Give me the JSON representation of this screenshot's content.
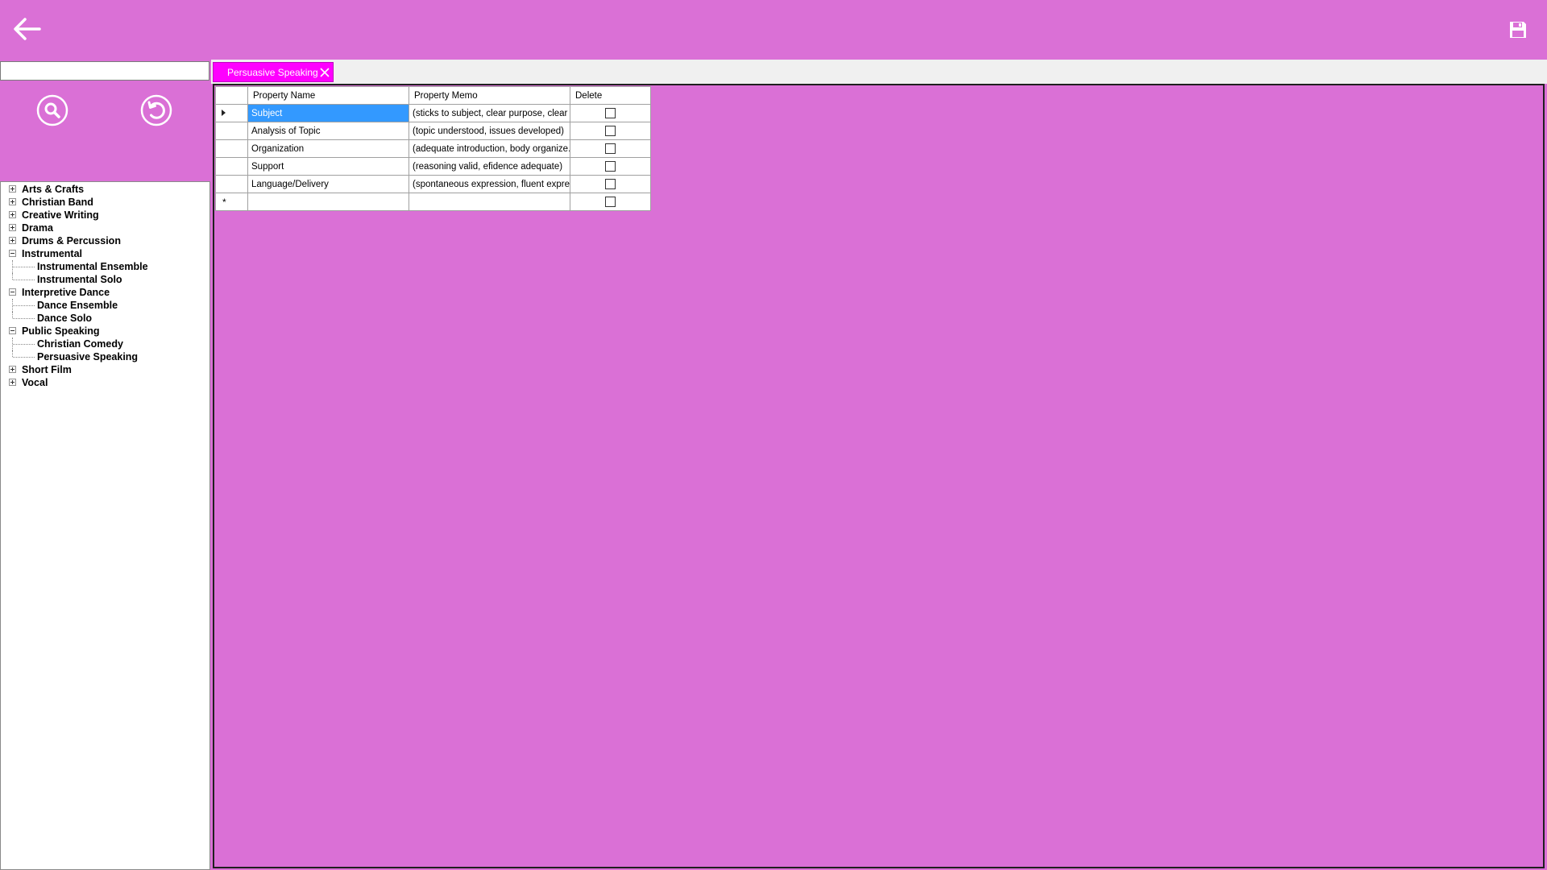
{
  "toolbar": {
    "back_icon": "arrow-left-icon",
    "save_icon": "floppy-disk-icon"
  },
  "search": {
    "value": "",
    "search_icon": "magnifier-icon",
    "reset_icon": "refresh-icon"
  },
  "tree": {
    "nodes": [
      {
        "label": "Arts & Crafts",
        "level": 0,
        "expander": "plus"
      },
      {
        "label": "Christian Band",
        "level": 0,
        "expander": "plus"
      },
      {
        "label": "Creative Writing",
        "level": 0,
        "expander": "plus"
      },
      {
        "label": "Drama",
        "level": 0,
        "expander": "plus"
      },
      {
        "label": "Drums & Percussion",
        "level": 0,
        "expander": "plus"
      },
      {
        "label": "Instrumental",
        "level": 0,
        "expander": "minus"
      },
      {
        "label": "Instrumental Ensemble",
        "level": 1
      },
      {
        "label": "Instrumental Solo",
        "level": 1
      },
      {
        "label": "Interpretive Dance",
        "level": 0,
        "expander": "minus"
      },
      {
        "label": "Dance Ensemble",
        "level": 1
      },
      {
        "label": "Dance Solo",
        "level": 1
      },
      {
        "label": "Public Speaking",
        "level": 0,
        "expander": "minus"
      },
      {
        "label": "Christian Comedy",
        "level": 1
      },
      {
        "label": "Persuasive Speaking",
        "level": 1
      },
      {
        "label": "Short Film",
        "level": 0,
        "expander": "plus"
      },
      {
        "label": "Vocal",
        "level": 0,
        "expander": "plus"
      }
    ]
  },
  "tabs": [
    {
      "label": "Persuasive Speaking",
      "active": true,
      "close_icon": "close-icon"
    }
  ],
  "grid": {
    "columns": [
      "Property Name",
      "Property Memo",
      "Delete"
    ],
    "rows": [
      {
        "name": "Subject",
        "memo": "(sticks to subject, clear purpose, clear ...",
        "delete": false,
        "current": true
      },
      {
        "name": "Analysis of Topic",
        "memo": "(topic understood, issues developed)",
        "delete": false
      },
      {
        "name": "Organization",
        "memo": "(adequate introduction, body organize...",
        "delete": false
      },
      {
        "name": "Support",
        "memo": "(reasoning valid, efidence adequate)",
        "delete": false
      },
      {
        "name": "Language/Delivery",
        "memo": "(spontaneous expression, fluent expres...",
        "delete": false
      }
    ],
    "new_row_marker": "*"
  },
  "colors": {
    "background": "#da70d6",
    "tab_active": "#ff00ff",
    "selection": "#3399ff"
  }
}
